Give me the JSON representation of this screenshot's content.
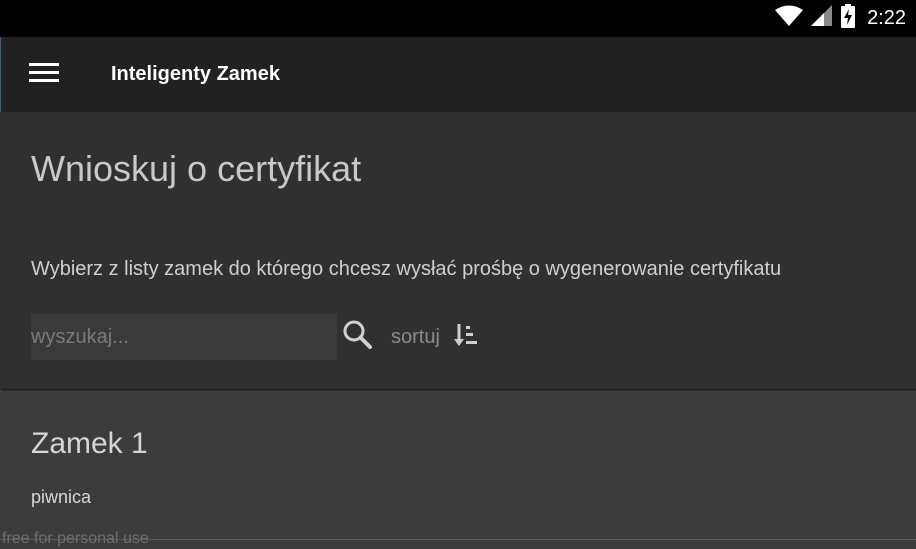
{
  "status_bar": {
    "time": "2:22",
    "icons": [
      "wifi-icon",
      "signal-icon",
      "battery-charging-icon"
    ]
  },
  "app_bar": {
    "title": "Inteligenty Zamek",
    "menu_icon": "hamburger-menu-icon"
  },
  "header": {
    "heading": "Wnioskuj o certyfikat",
    "instruction": "Wybierz z listy zamek do którego chcesz wysłać prośbę o wygenerowanie certyfikatu",
    "search": {
      "placeholder": "wyszukaj...",
      "value": ""
    },
    "search_icon": "search-icon",
    "sort": {
      "label": "sortuj",
      "icon": "sort-ascending-icon"
    }
  },
  "locks": [
    {
      "name": "Zamek 1",
      "location": "piwnica"
    }
  ],
  "watermark": "free for personal use",
  "colors": {
    "status_bar_bg": "#000000",
    "app_bar_bg": "#212121",
    "content_bg": "#303030",
    "list_item_bg": "#3c3c3c",
    "text_primary": "#ffffff",
    "text_secondary": "#cfcfcf"
  }
}
